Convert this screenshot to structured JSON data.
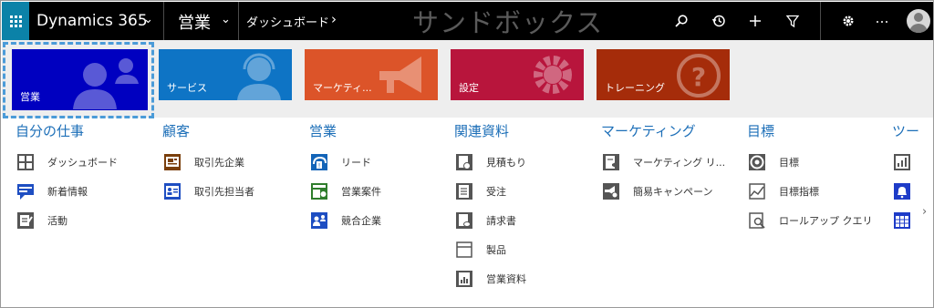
{
  "header": {
    "app_name": "Dynamics 365",
    "area": "営業",
    "breadcrumb": "ダッシュボード",
    "watermark": "サンドボックス"
  },
  "tiles": [
    {
      "label": "営業",
      "color": "#0000c0"
    },
    {
      "label": "サービス",
      "color": "#0e74c5"
    },
    {
      "label": "マーケティ...",
      "color": "#dc5429"
    },
    {
      "label": "設定",
      "color": "#b8153c"
    },
    {
      "label": "トレーニング",
      "color": "#a52c0a"
    }
  ],
  "columns": [
    {
      "title": "自分の仕事",
      "items": [
        {
          "label": "ダッシュボード",
          "icon": "dashboard-icon"
        },
        {
          "label": "新着情報",
          "icon": "news-icon"
        },
        {
          "label": "活動",
          "icon": "activity-icon"
        }
      ]
    },
    {
      "title": "顧客",
      "items": [
        {
          "label": "取引先企業",
          "icon": "account-icon"
        },
        {
          "label": "取引先担当者",
          "icon": "contact-icon"
        }
      ]
    },
    {
      "title": "営業",
      "items": [
        {
          "label": "リード",
          "icon": "lead-icon"
        },
        {
          "label": "営業案件",
          "icon": "opportunity-icon"
        },
        {
          "label": "競合企業",
          "icon": "competitor-icon"
        }
      ]
    },
    {
      "title": "関連資料",
      "items": [
        {
          "label": "見積もり",
          "icon": "quote-icon"
        },
        {
          "label": "受注",
          "icon": "order-icon"
        },
        {
          "label": "請求書",
          "icon": "invoice-icon"
        },
        {
          "label": "製品",
          "icon": "product-icon"
        },
        {
          "label": "営業資料",
          "icon": "sales-literature-icon"
        }
      ]
    },
    {
      "title": "マーケティング",
      "items": [
        {
          "label": "マーケティング リ...",
          "icon": "marketing-list-icon"
        },
        {
          "label": "簡易キャンペーン",
          "icon": "quick-campaign-icon"
        }
      ]
    },
    {
      "title": "目標",
      "items": [
        {
          "label": "目標",
          "icon": "goal-icon"
        },
        {
          "label": "目標指標",
          "icon": "goal-metric-icon"
        },
        {
          "label": "ロールアップ クエリ",
          "icon": "rollup-query-icon"
        }
      ]
    },
    {
      "title": "ツー",
      "items": [
        {
          "label": "",
          "icon": "report-icon"
        },
        {
          "label": "",
          "icon": "alert-icon"
        },
        {
          "label": "",
          "icon": "calendar-icon"
        }
      ]
    }
  ]
}
